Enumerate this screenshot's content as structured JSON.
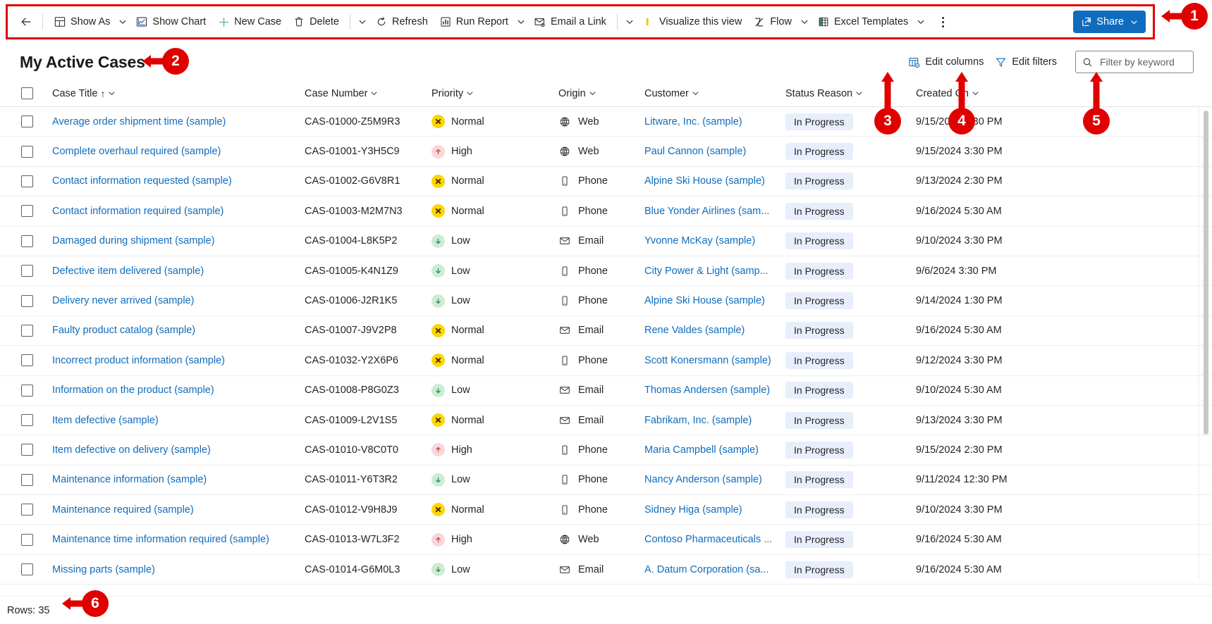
{
  "commandbar": {
    "back_label": "Back",
    "items": [
      {
        "id": "show-as",
        "label": "Show As",
        "icon": "show-as-icon",
        "caret": true
      },
      {
        "id": "show-chart",
        "label": "Show Chart",
        "icon": "show-chart-icon",
        "caret": false
      },
      {
        "id": "new-case",
        "label": "New Case",
        "icon": "plus-icon",
        "caret": false
      },
      {
        "id": "delete",
        "label": "Delete",
        "icon": "trash-icon",
        "caret": false
      },
      {
        "id": "refresh",
        "label": "Refresh",
        "icon": "refresh-icon",
        "caret": false
      },
      {
        "id": "run-report",
        "label": "Run Report",
        "icon": "report-icon",
        "caret": true
      },
      {
        "id": "email-a-link",
        "label": "Email a Link",
        "icon": "email-link-icon",
        "caret": false
      },
      {
        "id": "visualize",
        "label": "Visualize this view",
        "icon": "power-bi-icon",
        "caret": false
      },
      {
        "id": "flow",
        "label": "Flow",
        "icon": "flow-icon",
        "caret": true
      },
      {
        "id": "excel-templates",
        "label": "Excel Templates",
        "icon": "excel-icon",
        "caret": true
      }
    ],
    "overflow_label": "More commands",
    "share_label": "Share"
  },
  "view": {
    "title": "My Active Cases",
    "edit_columns_label": "Edit columns",
    "edit_filters_label": "Edit filters",
    "search_placeholder": "Filter by keyword",
    "search_value": ""
  },
  "grid": {
    "columns": [
      {
        "key": "title",
        "label": "Case Title",
        "sorted": true,
        "sort_glyph": "↑"
      },
      {
        "key": "number",
        "label": "Case Number",
        "sorted": false,
        "sort_glyph": ""
      },
      {
        "key": "prio",
        "label": "Priority",
        "sorted": false,
        "sort_glyph": ""
      },
      {
        "key": "origin",
        "label": "Origin",
        "sorted": false,
        "sort_glyph": ""
      },
      {
        "key": "cust",
        "label": "Customer",
        "sorted": false,
        "sort_glyph": ""
      },
      {
        "key": "status",
        "label": "Status Reason",
        "sorted": false,
        "sort_glyph": ""
      },
      {
        "key": "date",
        "label": "Created On",
        "sorted": false,
        "sort_glyph": ""
      }
    ],
    "rows": [
      {
        "title": "Average order shipment time (sample)",
        "number": "CAS-01000-Z5M9R3",
        "prio": "Normal",
        "origin": "Web",
        "cust": "Litware, Inc. (sample)",
        "status": "In Progress",
        "date": "9/15/2024 9:30 PM"
      },
      {
        "title": "Complete overhaul required (sample)",
        "number": "CAS-01001-Y3H5C9",
        "prio": "High",
        "origin": "Web",
        "cust": "Paul Cannon (sample)",
        "status": "In Progress",
        "date": "9/15/2024 3:30 PM"
      },
      {
        "title": "Contact information requested (sample)",
        "number": "CAS-01002-G6V8R1",
        "prio": "Normal",
        "origin": "Phone",
        "cust": "Alpine Ski House (sample)",
        "status": "In Progress",
        "date": "9/13/2024 2:30 PM"
      },
      {
        "title": "Contact information required (sample)",
        "number": "CAS-01003-M2M7N3",
        "prio": "Normal",
        "origin": "Phone",
        "cust": "Blue Yonder Airlines (sam...",
        "status": "In Progress",
        "date": "9/16/2024 5:30 AM"
      },
      {
        "title": "Damaged during shipment (sample)",
        "number": "CAS-01004-L8K5P2",
        "prio": "Low",
        "origin": "Email",
        "cust": "Yvonne McKay (sample)",
        "status": "In Progress",
        "date": "9/10/2024 3:30 PM"
      },
      {
        "title": "Defective item delivered (sample)",
        "number": "CAS-01005-K4N1Z9",
        "prio": "Low",
        "origin": "Phone",
        "cust": "City Power & Light (samp...",
        "status": "In Progress",
        "date": "9/6/2024 3:30 PM"
      },
      {
        "title": "Delivery never arrived (sample)",
        "number": "CAS-01006-J2R1K5",
        "prio": "Low",
        "origin": "Phone",
        "cust": "Alpine Ski House (sample)",
        "status": "In Progress",
        "date": "9/14/2024 1:30 PM"
      },
      {
        "title": "Faulty product catalog (sample)",
        "number": "CAS-01007-J9V2P8",
        "prio": "Normal",
        "origin": "Email",
        "cust": "Rene Valdes (sample)",
        "status": "In Progress",
        "date": "9/16/2024 5:30 AM"
      },
      {
        "title": "Incorrect product information (sample)",
        "number": "CAS-01032-Y2X6P6",
        "prio": "Normal",
        "origin": "Phone",
        "cust": "Scott Konersmann (sample)",
        "status": "In Progress",
        "date": "9/12/2024 3:30 PM"
      },
      {
        "title": "Information on the product (sample)",
        "number": "CAS-01008-P8G0Z3",
        "prio": "Low",
        "origin": "Email",
        "cust": "Thomas Andersen (sample)",
        "status": "In Progress",
        "date": "9/10/2024 5:30 AM"
      },
      {
        "title": "Item defective (sample)",
        "number": "CAS-01009-L2V1S5",
        "prio": "Normal",
        "origin": "Email",
        "cust": "Fabrikam, Inc. (sample)",
        "status": "In Progress",
        "date": "9/13/2024 3:30 PM"
      },
      {
        "title": "Item defective on delivery (sample)",
        "number": "CAS-01010-V8C0T0",
        "prio": "High",
        "origin": "Phone",
        "cust": "Maria Campbell (sample)",
        "status": "In Progress",
        "date": "9/15/2024 2:30 PM"
      },
      {
        "title": "Maintenance information (sample)",
        "number": "CAS-01011-Y6T3R2",
        "prio": "Low",
        "origin": "Phone",
        "cust": "Nancy Anderson (sample)",
        "status": "In Progress",
        "date": "9/11/2024 12:30 PM"
      },
      {
        "title": "Maintenance required (sample)",
        "number": "CAS-01012-V9H8J9",
        "prio": "Normal",
        "origin": "Phone",
        "cust": "Sidney Higa (sample)",
        "status": "In Progress",
        "date": "9/10/2024 3:30 PM"
      },
      {
        "title": "Maintenance time information required (sample)",
        "number": "CAS-01013-W7L3F2",
        "prio": "High",
        "origin": "Web",
        "cust": "Contoso Pharmaceuticals ...",
        "status": "In Progress",
        "date": "9/16/2024 5:30 AM"
      },
      {
        "title": "Missing parts (sample)",
        "number": "CAS-01014-G6M0L3",
        "prio": "Low",
        "origin": "Email",
        "cust": "A. Datum Corporation (sa...",
        "status": "In Progress",
        "date": "9/16/2024 5:30 AM"
      }
    ]
  },
  "footer": {
    "rows_label": "Rows: 35"
  },
  "annotations": {
    "accent_color": "#e00000",
    "markers": [
      {
        "id": "1",
        "label": "1"
      },
      {
        "id": "2",
        "label": "2"
      },
      {
        "id": "3",
        "label": "3"
      },
      {
        "id": "4",
        "label": "4"
      },
      {
        "id": "5",
        "label": "5"
      },
      {
        "id": "6",
        "label": "6"
      }
    ]
  }
}
